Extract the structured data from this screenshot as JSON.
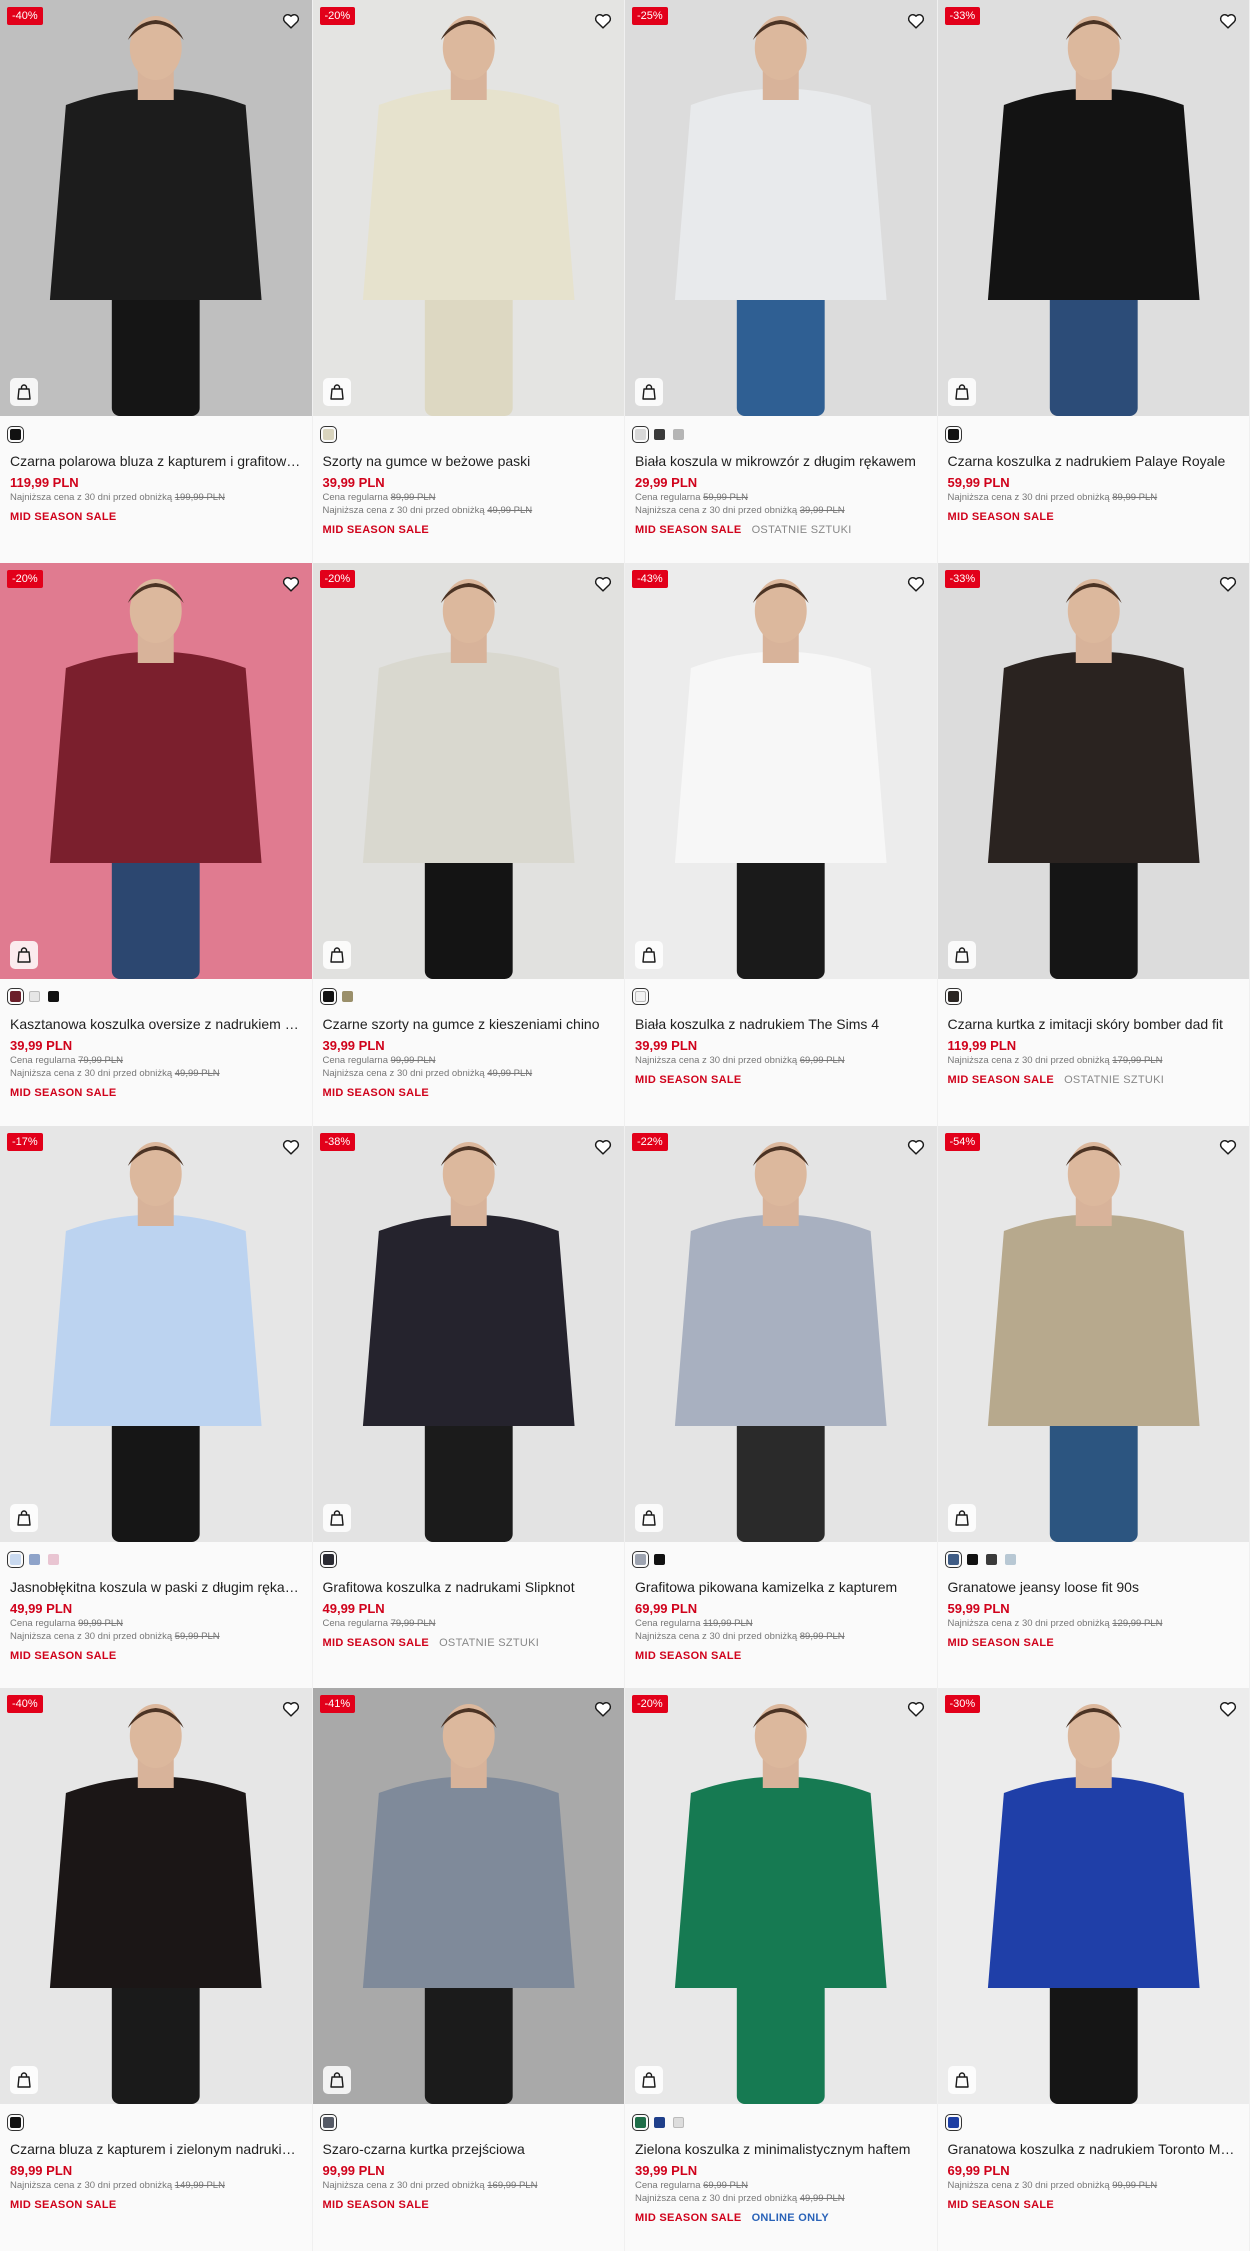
{
  "labels": {
    "regular_price": "Cena regularna",
    "lowest_price": "Najniższa cena z 30 dni przed obniżką"
  },
  "products": [
    {
      "discount": "-40%",
      "name": "Czarna polarowa bluza z kapturem i grafitowymi wstawkami",
      "price": "119,99 PLN",
      "regular": "",
      "lowest": "199,99 PLN",
      "tag": "MID SEASON SALE",
      "extra": "",
      "swatches": [
        "#111111"
      ],
      "bg": "#bfbfbf",
      "top": "#1c1c1c",
      "bottom": "#151515"
    },
    {
      "discount": "-20%",
      "name": "Szorty na gumce w beżowe paski",
      "price": "39,99 PLN",
      "regular": "89,99 PLN",
      "lowest": "49,99 PLN",
      "tag": "MID SEASON SALE",
      "extra": "",
      "swatches": [
        "#d9d4bd"
      ],
      "bg": "#e4e4e2",
      "top": "#e6e2cd",
      "bottom": "#ddd8c2"
    },
    {
      "discount": "-25%",
      "name": "Biała koszula w mikrowzór z długim rękawem",
      "price": "29,99 PLN",
      "regular": "59,99 PLN",
      "lowest": "39,99 PLN",
      "tag": "MID SEASON SALE",
      "extra": "OSTATNIE SZTUKI",
      "swatches": [
        "#d8d8d8",
        "#3a3a3a",
        "#b5b5b5"
      ],
      "bg": "#dcdcdc",
      "top": "#e8eaec",
      "bottom": "#2f5f93"
    },
    {
      "discount": "-33%",
      "name": "Czarna koszulka z nadrukiem Palaye Royale",
      "price": "59,99 PLN",
      "regular": "",
      "lowest": "89,99 PLN",
      "tag": "MID SEASON SALE",
      "extra": "",
      "swatches": [
        "#111111"
      ],
      "bg": "#dedede",
      "top": "#131313",
      "bottom": "#2c4c78"
    },
    {
      "discount": "-20%",
      "name": "Kasztanowa koszulka oversize z nadrukiem i paskami",
      "price": "39,99 PLN",
      "regular": "79,99 PLN",
      "lowest": "49,99 PLN",
      "tag": "MID SEASON SALE",
      "extra": "",
      "swatches": [
        "#6b1e2a",
        "#e6e6e6",
        "#111111"
      ],
      "bg": "#e07b90",
      "top": "#7b1f2d",
      "bottom": "#2c4770"
    },
    {
      "discount": "-20%",
      "name": "Czarne szorty na gumce z kieszeniami chino",
      "price": "39,99 PLN",
      "regular": "99,99 PLN",
      "lowest": "49,99 PLN",
      "tag": "MID SEASON SALE",
      "extra": "",
      "swatches": [
        "#111111",
        "#9a8f6a"
      ],
      "bg": "#e1e1df",
      "top": "#d9d8cf",
      "bottom": "#141414"
    },
    {
      "discount": "-43%",
      "name": "Biała koszulka z nadrukiem The Sims 4",
      "price": "39,99 PLN",
      "regular": "",
      "lowest": "69,99 PLN",
      "tag": "MID SEASON SALE",
      "extra": "",
      "swatches": [
        "#f2f2f2"
      ],
      "bg": "#ececec",
      "top": "#f7f7f7",
      "bottom": "#1a1a1a"
    },
    {
      "discount": "-33%",
      "name": "Czarna kurtka z imitacji skóry bomber dad fit",
      "price": "119,99 PLN",
      "regular": "",
      "lowest": "179,99 PLN",
      "tag": "MID SEASON SALE",
      "extra": "OSTATNIE SZTUKI",
      "swatches": [
        "#2a2522"
      ],
      "bg": "#dcdcdc",
      "top": "#2a2320",
      "bottom": "#151515"
    },
    {
      "discount": "-17%",
      "name": "Jasnobłękitna koszula w paski z długim rękawem",
      "price": "49,99 PLN",
      "regular": "99,99 PLN",
      "lowest": "59,99 PLN",
      "tag": "MID SEASON SALE",
      "extra": "",
      "swatches": [
        "#c9d9ef",
        "#8ea3c9",
        "#e9c5d2"
      ],
      "bg": "#e6e6e6",
      "top": "#bcd3f0",
      "bottom": "#161616"
    },
    {
      "discount": "-38%",
      "name": "Grafitowa koszulka z nadrukami Slipknot",
      "price": "49,99 PLN",
      "regular": "79,99 PLN",
      "lowest": "",
      "tag": "MID SEASON SALE",
      "extra": "OSTATNIE SZTUKI",
      "swatches": [
        "#2b2b33"
      ],
      "bg": "#e3e3e3",
      "top": "#25232d",
      "bottom": "#1b1b1b"
    },
    {
      "discount": "-22%",
      "name": "Grafitowa pikowana kamizelka z kapturem",
      "price": "69,99 PLN",
      "regular": "119,99 PLN",
      "lowest": "89,99 PLN",
      "tag": "MID SEASON SALE",
      "extra": "",
      "swatches": [
        "#9da3b0",
        "#111111"
      ],
      "bg": "#e4e4e4",
      "top": "#a8b0c0",
      "bottom": "#2a2a2a"
    },
    {
      "discount": "-54%",
      "name": "Granatowe jeansy loose fit 90s",
      "price": "59,99 PLN",
      "regular": "",
      "lowest": "129,99 PLN",
      "tag": "MID SEASON SALE",
      "extra": "",
      "swatches": [
        "#3f5c85",
        "#111111",
        "#3a3a3a",
        "#b8c8d4"
      ],
      "bg": "#e7e7e7",
      "top": "#b7a98d",
      "bottom": "#2c5580"
    },
    {
      "discount": "-40%",
      "name": "Czarna bluza z kapturem i zielonym nadrukiem twarzy",
      "price": "89,99 PLN",
      "regular": "",
      "lowest": "149,99 PLN",
      "tag": "MID SEASON SALE",
      "extra": "",
      "swatches": [
        "#111111"
      ],
      "bg": "#e6e6e6",
      "top": "#1b1616",
      "bottom": "#1a1a1a"
    },
    {
      "discount": "-41%",
      "name": "Szaro-czarna kurtka przejściowa",
      "price": "99,99 PLN",
      "regular": "",
      "lowest": "169,99 PLN",
      "tag": "MID SEASON SALE",
      "extra": "",
      "swatches": [
        "#555a66"
      ],
      "bg": "#a9a9a9",
      "top": "#7f8a9a",
      "bottom": "#1b1b1b"
    },
    {
      "discount": "-20%",
      "name": "Zielona koszulka z minimalistycznym haftem",
      "price": "39,99 PLN",
      "regular": "69,99 PLN",
      "lowest": "49,99 PLN",
      "tag": "MID SEASON SALE",
      "extra": "ONLINE ONLY",
      "swatches": [
        "#1f6e49",
        "#1f3f8a",
        "#dddddd"
      ],
      "bg": "#e8e8e8",
      "top": "#167a52",
      "bottom": "#167a52"
    },
    {
      "discount": "-30%",
      "name": "Granatowa koszulka z nadrukiem Toronto Maple Leafs",
      "price": "69,99 PLN",
      "regular": "",
      "lowest": "99,99 PLN",
      "tag": "MID SEASON SALE",
      "extra": "",
      "swatches": [
        "#1d3ea3"
      ],
      "bg": "#ececec",
      "top": "#1f3fa8",
      "bottom": "#151515"
    }
  ]
}
